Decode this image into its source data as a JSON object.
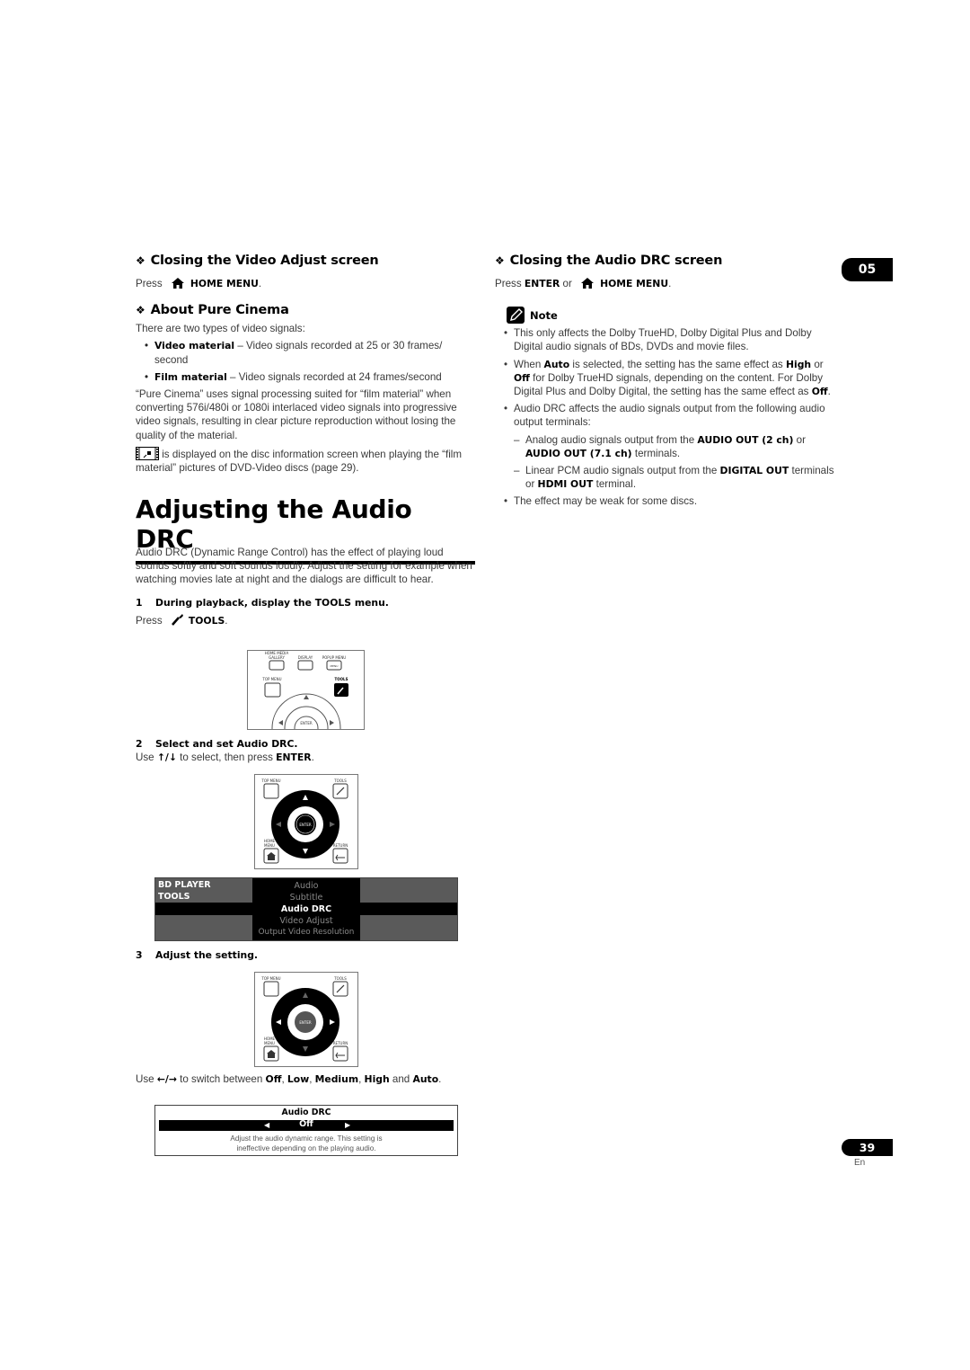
{
  "chapter_tab": "05",
  "page_number": "39",
  "language": "En",
  "left": {
    "closing_video": {
      "heading": "Closing the Video Adjust screen",
      "press": "Press",
      "button": "HOME MENU",
      "end": "."
    },
    "pure_cinema": {
      "heading": "About Pure Cinema",
      "intro": "There are two types of video signals:",
      "bullets": [
        {
          "term": "Video material",
          "text": " – Video signals recorded at 25 or 30 frames/ second"
        },
        {
          "term": "Film material",
          "text": " – Video signals recorded at 24 frames/second"
        }
      ],
      "para1": "“Pure Cinema” uses signal processing suited for “film material” when converting 576i/480i or 1080i interlaced video signals into progressive video signals, resulting in clear picture reproduction without losing the quality of the material.",
      "para2": " is displayed on the disc information screen when playing the “film material” pictures of DVD-Video discs (page 29)."
    },
    "section": {
      "title": "Adjusting the Audio DRC",
      "intro": "Audio DRC (Dynamic Range Control) has the effect of playing loud sounds softly and soft sounds loudly. Adjust the setting for example when watching movies late at night and the dialogs are difficult to hear.",
      "step1": {
        "num": "1",
        "title": "During playback, display the TOOLS menu.",
        "press": "Press",
        "button": "TOOLS",
        "end": "."
      },
      "step2": {
        "num": "2",
        "title": "Select and set Audio DRC.",
        "use": "Use",
        "arrows": "↑/↓",
        "mid": " to select, then press ",
        "button": "ENTER",
        "end": "."
      },
      "step3": {
        "num": "3",
        "title": "Adjust the setting.",
        "use": "Use",
        "arrows": "←/→",
        "mid": " to switch between ",
        "options": [
          "Off",
          "Low",
          "Medium",
          "High",
          "Auto"
        ],
        "and": " and "
      }
    },
    "remote1": {
      "labels": [
        "HOME MEDIA GALLERY",
        "DISPLAY",
        "POPUP MENU",
        "MENU",
        "TOP MENU",
        "TOOLS",
        "ENTER"
      ]
    },
    "remote2": {
      "labels": [
        "TOP MENU",
        "TOOLS",
        "ENTER",
        "HOME MENU",
        "RETURN"
      ]
    },
    "tools_menu": {
      "header_line1": "BD PLAYER",
      "header_line2": "TOOLS",
      "items": [
        "Audio",
        "Subtitle",
        "Audio DRC",
        "Video Adjust",
        "Output Video Resolution"
      ],
      "selected_index": 2
    },
    "drc_screen": {
      "title": "Audio DRC",
      "value": "Off",
      "left_arrow": "◀",
      "right_arrow": "▶",
      "desc_line1": "Adjust the audio dynamic range. This setting is",
      "desc_line2": "ineffective depending on the playing audio."
    }
  },
  "right": {
    "closing_audio": {
      "heading": "Closing the Audio DRC screen",
      "press": "Press ",
      "enter": "ENTER",
      "or": " or ",
      "button": "HOME MENU",
      "end": "."
    },
    "note": {
      "label": "Note",
      "b1": "This only affects the Dolby TrueHD, Dolby Digital Plus and Dolby Digital audio signals of BDs, DVDs and movie files.",
      "b2": {
        "p1": "When ",
        "auto": "Auto",
        "p2": " is selected, the setting has the same effect as ",
        "high": "High",
        "p3": " or ",
        "off": "Off",
        "p4": " for Dolby TrueHD signals, depending on the content. For Dolby Digital Plus and Dolby Digital, the setting has the same effect as ",
        "off2": "Off",
        "p5": "."
      },
      "b3": "Audio DRC affects the audio signals output from the following audio output terminals:",
      "d1": {
        "p1": "Analog audio signals output from the ",
        "t1": "AUDIO OUT (2 ch)",
        "p2": " or ",
        "t2": "AUDIO OUT (7.1 ch)",
        "p3": " terminals."
      },
      "d2": {
        "p1": "Linear PCM audio signals output from the ",
        "t1": "DIGITAL OUT",
        "p2": " terminals or ",
        "t2": "HDMI OUT",
        "p3": " terminal."
      },
      "b4": "The effect may be weak for some discs."
    }
  }
}
